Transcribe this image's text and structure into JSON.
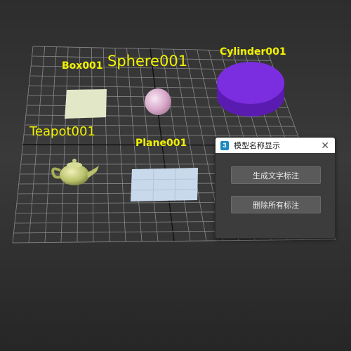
{
  "viewport": {
    "objects": [
      {
        "name": "Box001"
      },
      {
        "name": "Sphere001"
      },
      {
        "name": "Cylinder001"
      },
      {
        "name": "Teapot001"
      },
      {
        "name": "Plane001"
      }
    ],
    "colors": {
      "label": "#f2f200",
      "grid": "#8a8a8a",
      "cylinder": "#7a2ee0",
      "box": "#e2e7c8",
      "sphere": "#e7c7de",
      "teapot": "#c6d080",
      "plane": "#c9d9ec"
    }
  },
  "dialog": {
    "title": "模型名称显示",
    "app_icon": "3",
    "close_icon": "close-icon",
    "buttons": {
      "generate": "生成文字标注",
      "delete": "删除所有标注"
    }
  }
}
